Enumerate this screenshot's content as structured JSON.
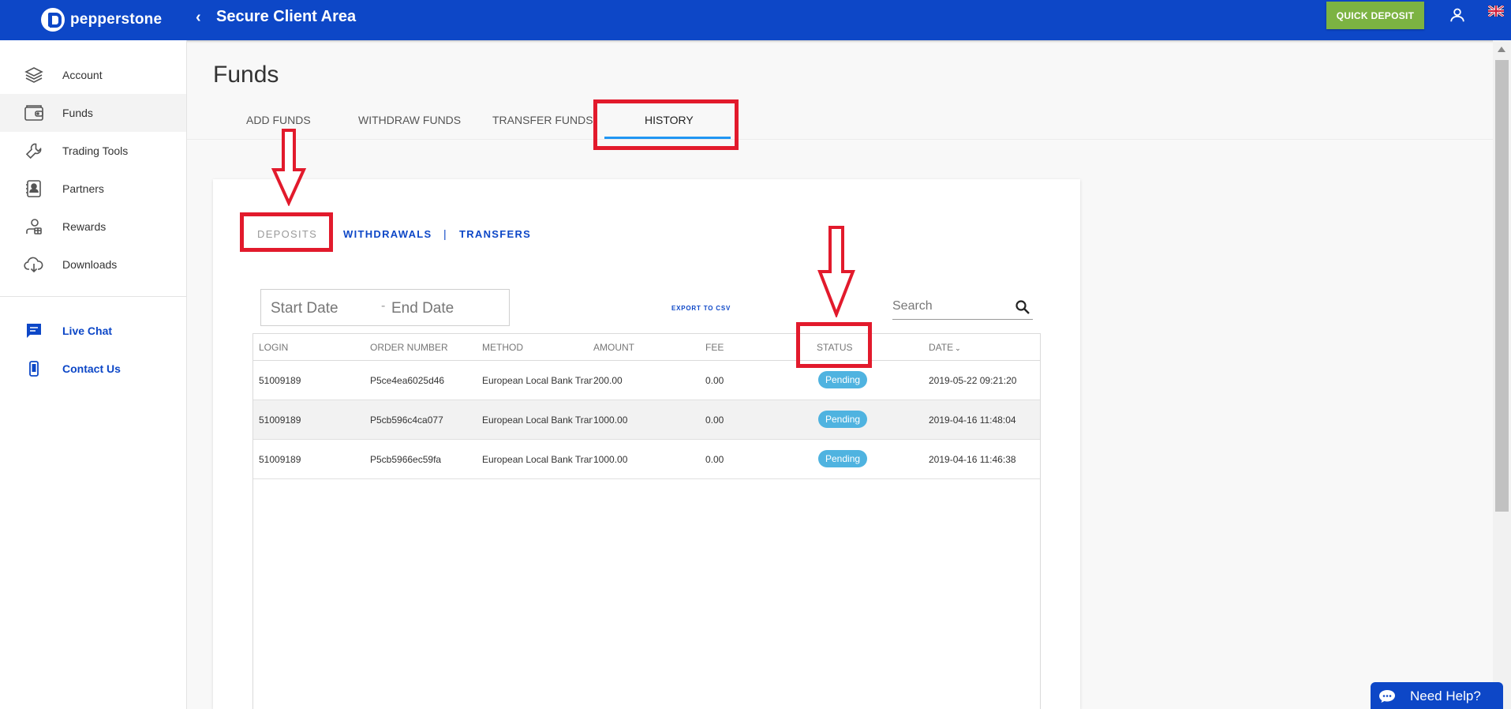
{
  "header": {
    "logo_text": "pepperstone",
    "title": "Secure Client Area",
    "quick_deposit": "QUICK DEPOSIT",
    "brand_color": "#0d47c7"
  },
  "sidebar": {
    "items": [
      {
        "label": "Account",
        "icon": "layers-icon"
      },
      {
        "label": "Funds",
        "icon": "wallet-icon"
      },
      {
        "label": "Trading Tools",
        "icon": "wrench-icon"
      },
      {
        "label": "Partners",
        "icon": "contact-card-icon"
      },
      {
        "label": "Rewards",
        "icon": "rewards-icon"
      },
      {
        "label": "Downloads",
        "icon": "cloud-download-icon"
      }
    ],
    "support": [
      {
        "label": "Live Chat",
        "icon": "chat-icon"
      },
      {
        "label": "Contact Us",
        "icon": "phone-icon"
      }
    ]
  },
  "main": {
    "title": "Funds",
    "tabs": [
      "ADD FUNDS",
      "WITHDRAW FUNDS",
      "TRANSFER FUNDS",
      "HISTORY"
    ],
    "active_tab": "HISTORY",
    "subtabs": [
      "DEPOSITS",
      "WITHDRAWALS",
      "TRANSFERS"
    ],
    "subtab_separator": "|",
    "start_date_placeholder": "Start Date",
    "end_date_placeholder": "End Date",
    "date_separator": "-",
    "export_label": "EXPORT TO CSV",
    "search_placeholder": "Search"
  },
  "table": {
    "columns": [
      "LOGIN",
      "ORDER NUMBER",
      "METHOD",
      "AMOUNT",
      "FEE",
      "STATUS",
      "DATE"
    ],
    "rows": [
      {
        "login": "51009189",
        "order": "P5ce4ea6025d46",
        "method": "European Local Bank Transfer",
        "amount": "200.00",
        "fee": "0.00",
        "status": "Pending",
        "date": "2019-05-22 09:21:20"
      },
      {
        "login": "51009189",
        "order": "P5cb596c4ca077",
        "method": "European Local Bank Transfer",
        "amount": "1000.00",
        "fee": "0.00",
        "status": "Pending",
        "date": "2019-04-16 11:48:04"
      },
      {
        "login": "51009189",
        "order": "P5cb5966ec59fa",
        "method": "European Local Bank Transfer",
        "amount": "1000.00",
        "fee": "0.00",
        "status": "Pending",
        "date": "2019-04-16 11:46:38"
      }
    ],
    "status_color": "#4fb3e0"
  },
  "help": {
    "label": "Need Help?"
  },
  "annotation_color": "#e21a2c"
}
